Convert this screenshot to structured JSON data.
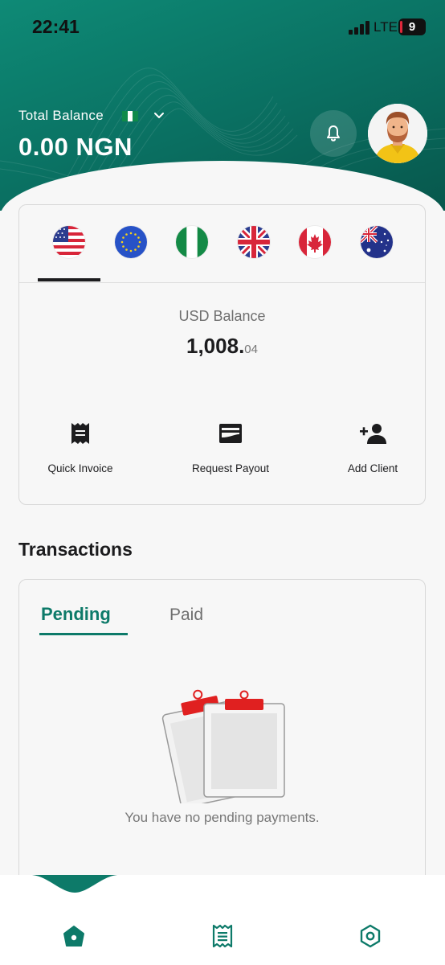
{
  "status_bar": {
    "time": "22:41",
    "network": "LTE",
    "battery": "9"
  },
  "header": {
    "balance_label": "Total Balance",
    "balance_value": "0.00 NGN",
    "currency_flag_icon": "nigeria-flag-icon"
  },
  "currency_tabs": [
    {
      "icon": "us-flag-icon",
      "selected": true
    },
    {
      "icon": "eu-flag-icon",
      "selected": false
    },
    {
      "icon": "nigeria-flag-icon",
      "selected": false
    },
    {
      "icon": "uk-flag-icon",
      "selected": false
    },
    {
      "icon": "canada-flag-icon",
      "selected": false
    },
    {
      "icon": "australia-flag-icon",
      "selected": false
    }
  ],
  "balance_card": {
    "label": "USD Balance",
    "amount_main": "1,008.",
    "amount_cents": "04"
  },
  "actions": [
    {
      "label": "Quick Invoice",
      "icon": "invoice-icon"
    },
    {
      "label": "Request Payout",
      "icon": "wallet-icon"
    },
    {
      "label": "Add Client",
      "icon": "add-person-icon"
    }
  ],
  "transactions": {
    "title": "Transactions",
    "tabs": {
      "pending": "Pending",
      "paid": "Paid"
    },
    "empty_message": "You have no pending payments."
  },
  "bottom_nav": [
    {
      "icon": "home-icon",
      "active": true
    },
    {
      "icon": "receipt-list-icon",
      "active": false
    },
    {
      "icon": "settings-icon",
      "active": false
    }
  ],
  "colors": {
    "brand": "#0d7a69",
    "accent_red": "#e02020"
  }
}
